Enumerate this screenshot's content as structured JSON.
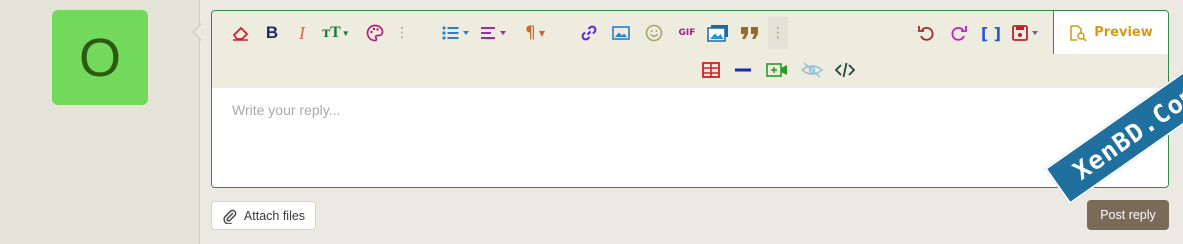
{
  "user": {
    "avatar_letter": "O"
  },
  "editor": {
    "placeholder": "Write your reply...",
    "preview_label": "Preview",
    "more_label": "⋮",
    "gif_label": "GIF"
  },
  "actions": {
    "attach_label": "Attach files",
    "post_label": "Post reply"
  },
  "watermark": {
    "text": "XenBD.Com"
  },
  "colors": {
    "border_green": "#2f8a43",
    "toolbar_bg": "#eeebdf",
    "avatar_bg": "#73d95b",
    "post_bg": "#7a6a58",
    "watermark_bg": "#1f6f9f"
  },
  "toolbar_icons": [
    "eraser-icon",
    "bold-icon",
    "italic-icon",
    "font-size-icon",
    "palette-icon",
    "more-icon",
    "list-icon",
    "align-icon",
    "paragraph-icon",
    "link-icon",
    "image-icon",
    "smiley-icon",
    "gif-icon",
    "media-gallery-icon",
    "quote-icon",
    "more-icon",
    "undo-icon",
    "redo-icon",
    "bbcode-icon",
    "drafts-icon",
    "table-icon",
    "horizontal-line-icon",
    "video-icon",
    "spoiler-icon",
    "code-icon"
  ]
}
